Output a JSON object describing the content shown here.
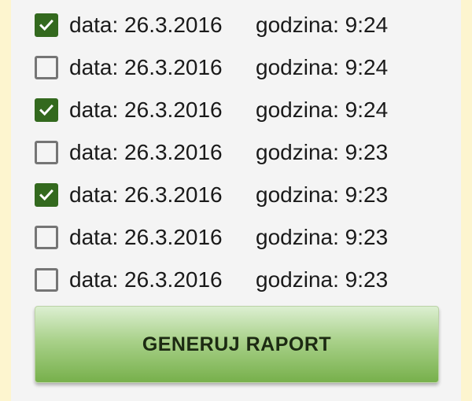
{
  "entries": [
    {
      "checked": true,
      "date": "data: 26.3.2016",
      "time": "godzina: 9:24"
    },
    {
      "checked": false,
      "date": "data: 26.3.2016",
      "time": "godzina: 9:24"
    },
    {
      "checked": true,
      "date": "data: 26.3.2016",
      "time": "godzina: 9:24"
    },
    {
      "checked": false,
      "date": "data: 26.3.2016",
      "time": "godzina: 9:23"
    },
    {
      "checked": true,
      "date": "data: 26.3.2016",
      "time": "godzina: 9:23"
    },
    {
      "checked": false,
      "date": "data: 26.3.2016",
      "time": "godzina: 9:23"
    },
    {
      "checked": false,
      "date": "data: 26.3.2016",
      "time": "godzina: 9:23"
    }
  ],
  "generate_button": {
    "label": "GENERUJ RAPORT"
  },
  "colors": {
    "checkbox_checked": "#33691e",
    "checkbox_unchecked_border": "#757575",
    "button_gradient_top": "#dcefd1",
    "button_gradient_bottom": "#77b04b",
    "panel_background": "#f4f4f4",
    "side_border": "#fdf5cf"
  },
  "icons": {
    "checkmark": "checkmark-icon"
  }
}
